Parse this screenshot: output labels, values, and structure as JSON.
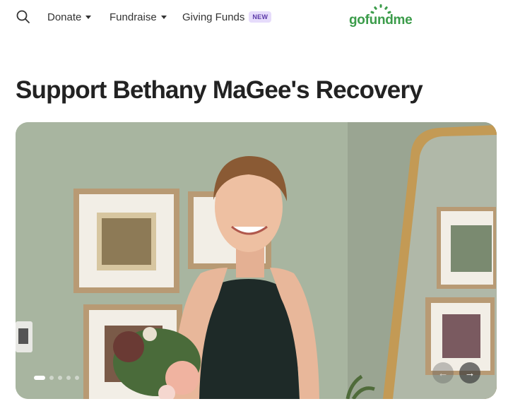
{
  "nav": {
    "donate_label": "Donate",
    "fundraise_label": "Fundraise",
    "giving_funds_label": "Giving Funds",
    "giving_funds_badge": "NEW",
    "logo_text": "gofundme",
    "brand_color": "#3b9c4a"
  },
  "campaign": {
    "title": "Support Bethany MaGee's Recovery"
  },
  "carousel": {
    "slide_count": 5,
    "active_slide": 1,
    "prev_icon": "←",
    "next_icon": "→"
  }
}
